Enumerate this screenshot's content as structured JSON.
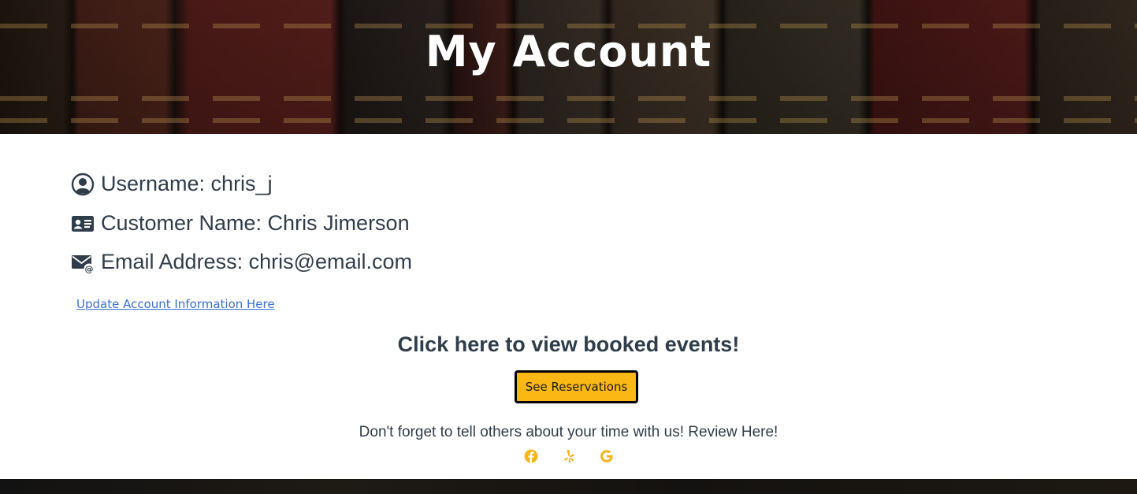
{
  "hero": {
    "title": "My Account"
  },
  "account": {
    "username": "Username: chris_j",
    "customer_name": "Customer Name: Chris Jimerson",
    "email": "Email Address: chris@email.com",
    "update_link": "Update Account Information Here"
  },
  "reservations": {
    "heading": "Click here to view booked events!",
    "button_label": "See Reservations"
  },
  "review": {
    "text": "Don't forget to tell others about your time with us! Review Here!",
    "links": [
      {
        "icon": "facebook-icon"
      },
      {
        "icon": "yelp-icon"
      },
      {
        "icon": "google-icon"
      }
    ]
  },
  "colors": {
    "accent": "#fbb814",
    "text": "#2f3d4a",
    "link": "#3b6fd4",
    "social": "#f5b521"
  }
}
